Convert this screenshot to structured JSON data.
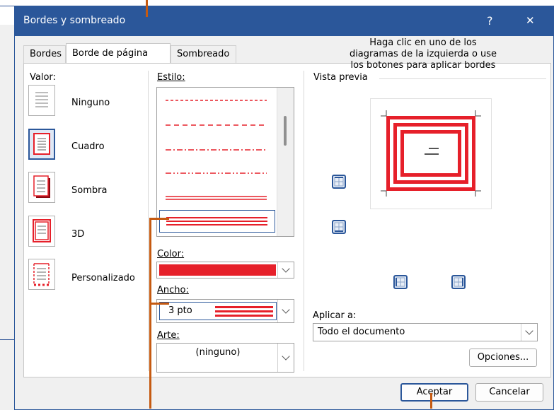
{
  "dialog": {
    "title": "Bordes y sombreado",
    "help": "?",
    "close": "✕"
  },
  "tabs": [
    {
      "label": "Bordes",
      "active": false
    },
    {
      "label": "Borde de página",
      "active": true
    },
    {
      "label": "Sombreado",
      "active": false
    }
  ],
  "setting": {
    "heading": "Valor:",
    "items": [
      {
        "label": "Ninguno",
        "selected": false
      },
      {
        "label": "Cuadro",
        "selected": true
      },
      {
        "label": "Sombra",
        "selected": false
      },
      {
        "label": "3D",
        "selected": false
      },
      {
        "label": "Personalizado",
        "selected": false
      }
    ]
  },
  "style": {
    "heading": "Estilo:",
    "options": [
      "dashed",
      "dashed-long",
      "dash-dot",
      "dash-dot-dot",
      "double",
      "double-thick"
    ],
    "selected_index": 5
  },
  "color": {
    "label": "Color:",
    "value_hex": "#e6202a"
  },
  "width": {
    "label": "Ancho:",
    "value": "3 pto"
  },
  "art": {
    "label": "Arte:",
    "value": "(ninguno)"
  },
  "preview": {
    "heading": "Vista previa",
    "instructions": "Haga clic en uno de los diagramas de la izquierda o use los botones para aplicar bordes"
  },
  "apply_to": {
    "label": "Aplicar a:",
    "value": "Todo el documento"
  },
  "buttons": {
    "options": "Opciones...",
    "ok": "Aceptar",
    "cancel": "Cancelar"
  },
  "colors": {
    "accent": "#2b579a",
    "border_red": "#e6202a",
    "callout": "#c55a11"
  }
}
